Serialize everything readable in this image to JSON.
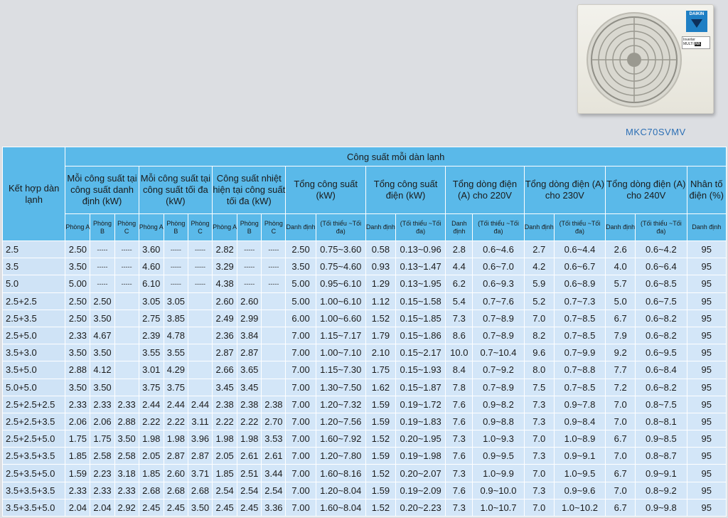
{
  "product": {
    "model": "MKC70SVMV",
    "brand_logo": "DAIKIN",
    "tag_lines": [
      "Inverter",
      "MULTI",
      "NX"
    ]
  },
  "table": {
    "combo_header": "Kết hợp dàn lạnh",
    "group_header": "Công suất mỗi dàn lạnh",
    "col_headers": [
      "Mỗi công suất tại công suất danh định (kW)",
      "Mỗi công suất tại công suất tối đa (kW)",
      "Công suất nhiệt hiện tại công suất tối đa (kW)",
      "Tổng công suất (kW)",
      "Tổng công suất điện (kW)",
      "Tổng dòng điện (A) cho 220V",
      "Tổng dòng điện (A) cho 230V",
      "Tổng dòng điện (A) cho 240V",
      "Nhân tố điện (%)"
    ],
    "room_labels": [
      "Phòng A",
      "Phòng B",
      "Phòng C"
    ],
    "rated_label": "Danh định",
    "range_label": "(Tối thiểu ~Tối đa)",
    "rows": [
      [
        "2.5",
        "2.50",
        "-----",
        "-----",
        "3.60",
        "-----",
        "-----",
        "2.82",
        "-----",
        "-----",
        "2.50",
        "0.75~3.60",
        "0.58",
        "0.13~0.96",
        "2.8",
        "0.6~4.6",
        "2.7",
        "0.6~4.4",
        "2.6",
        "0.6~4.2",
        "95"
      ],
      [
        "3.5",
        "3.50",
        "-----",
        "-----",
        "4.60",
        "-----",
        "-----",
        "3.29",
        "-----",
        "-----",
        "3.50",
        "0.75~4.60",
        "0.93",
        "0.13~1.47",
        "4.4",
        "0.6~7.0",
        "4.2",
        "0.6~6.7",
        "4.0",
        "0.6~6.4",
        "95"
      ],
      [
        "5.0",
        "5.00",
        "-----",
        "-----",
        "6.10",
        "-----",
        "-----",
        "4.38",
        "-----",
        "-----",
        "5.00",
        "0.95~6.10",
        "1.29",
        "0.13~1.95",
        "6.2",
        "0.6~9.3",
        "5.9",
        "0.6~8.9",
        "5.7",
        "0.6~8.5",
        "95"
      ],
      [
        "2.5+2.5",
        "2.50",
        "2.50",
        "",
        "3.05",
        "3.05",
        "",
        "2.60",
        "2.60",
        "",
        "5.00",
        "1.00~6.10",
        "1.12",
        "0.15~1.58",
        "5.4",
        "0.7~7.6",
        "5.2",
        "0.7~7.3",
        "5.0",
        "0.6~7.5",
        "95"
      ],
      [
        "2.5+3.5",
        "2.50",
        "3.50",
        "",
        "2.75",
        "3.85",
        "",
        "2.49",
        "2.99",
        "",
        "6.00",
        "1.00~6.60",
        "1.52",
        "0.15~1.85",
        "7.3",
        "0.7~8.9",
        "7.0",
        "0.7~8.5",
        "6.7",
        "0.6~8.2",
        "95"
      ],
      [
        "2.5+5.0",
        "2.33",
        "4.67",
        "",
        "2.39",
        "4.78",
        "",
        "2.36",
        "3.84",
        "",
        "7.00",
        "1.15~7.17",
        "1.79",
        "0.15~1.86",
        "8.6",
        "0.7~8.9",
        "8.2",
        "0.7~8.5",
        "7.9",
        "0.6~8.2",
        "95"
      ],
      [
        "3.5+3.0",
        "3.50",
        "3.50",
        "",
        "3.55",
        "3.55",
        "",
        "2.87",
        "2.87",
        "",
        "7.00",
        "1.00~7.10",
        "2.10",
        "0.15~2.17",
        "10.0",
        "0.7~10.4",
        "9.6",
        "0.7~9.9",
        "9.2",
        "0.6~9.5",
        "95"
      ],
      [
        "3.5+5.0",
        "2.88",
        "4.12",
        "",
        "3.01",
        "4.29",
        "",
        "2.66",
        "3.65",
        "",
        "7.00",
        "1.15~7.30",
        "1.75",
        "0.15~1.93",
        "8.4",
        "0.7~9.2",
        "8.0",
        "0.7~8.8",
        "7.7",
        "0.6~8.4",
        "95"
      ],
      [
        "5.0+5.0",
        "3.50",
        "3.50",
        "",
        "3.75",
        "3.75",
        "",
        "3.45",
        "3.45",
        "",
        "7.00",
        "1.30~7.50",
        "1.62",
        "0.15~1.87",
        "7.8",
        "0.7~8.9",
        "7.5",
        "0.7~8.5",
        "7.2",
        "0.6~8.2",
        "95"
      ],
      [
        "2.5+2.5+2.5",
        "2.33",
        "2.33",
        "2.33",
        "2.44",
        "2.44",
        "2.44",
        "2.38",
        "2.38",
        "2.38",
        "7.00",
        "1.20~7.32",
        "1.59",
        "0.19~1.72",
        "7.6",
        "0.9~8.2",
        "7.3",
        "0.9~7.8",
        "7.0",
        "0.8~7.5",
        "95"
      ],
      [
        "2.5+2.5+3.5",
        "2.06",
        "2.06",
        "2.88",
        "2.22",
        "2.22",
        "3.11",
        "2.22",
        "2.22",
        "2.70",
        "7.00",
        "1.20~7.56",
        "1.59",
        "0.19~1.83",
        "7.6",
        "0.9~8.8",
        "7.3",
        "0.9~8.4",
        "7.0",
        "0.8~8.1",
        "95"
      ],
      [
        "2.5+2.5+5.0",
        "1.75",
        "1.75",
        "3.50",
        "1.98",
        "1.98",
        "3.96",
        "1.98",
        "1.98",
        "3.53",
        "7.00",
        "1.60~7.92",
        "1.52",
        "0.20~1.95",
        "7.3",
        "1.0~9.3",
        "7.0",
        "1.0~8.9",
        "6.7",
        "0.9~8.5",
        "95"
      ],
      [
        "2.5+3.5+3.5",
        "1.85",
        "2.58",
        "2.58",
        "2.05",
        "2.87",
        "2.87",
        "2.05",
        "2.61",
        "2.61",
        "7.00",
        "1.20~7.80",
        "1.59",
        "0.19~1.98",
        "7.6",
        "0.9~9.5",
        "7.3",
        "0.9~9.1",
        "7.0",
        "0.8~8.7",
        "95"
      ],
      [
        "2.5+3.5+5.0",
        "1.59",
        "2.23",
        "3.18",
        "1.85",
        "2.60",
        "3.71",
        "1.85",
        "2.51",
        "3.44",
        "7.00",
        "1.60~8.16",
        "1.52",
        "0.20~2.07",
        "7.3",
        "1.0~9.9",
        "7.0",
        "1.0~9.5",
        "6.7",
        "0.9~9.1",
        "95"
      ],
      [
        "3.5+3.5+3.5",
        "2.33",
        "2.33",
        "2.33",
        "2.68",
        "2.68",
        "2.68",
        "2.54",
        "2.54",
        "2.54",
        "7.00",
        "1.20~8.04",
        "1.59",
        "0.19~2.09",
        "7.6",
        "0.9~10.0",
        "7.3",
        "0.9~9.6",
        "7.0",
        "0.8~9.2",
        "95"
      ],
      [
        "3.5+3.5+5.0",
        "2.04",
        "2.04",
        "2.92",
        "2.45",
        "2.45",
        "3.50",
        "2.45",
        "2.45",
        "3.36",
        "7.00",
        "1.60~8.04",
        "1.52",
        "0.20~2.23",
        "7.3",
        "1.0~10.7",
        "7.0",
        "1.0~10.2",
        "6.7",
        "0.9~9.8",
        "95"
      ]
    ]
  }
}
